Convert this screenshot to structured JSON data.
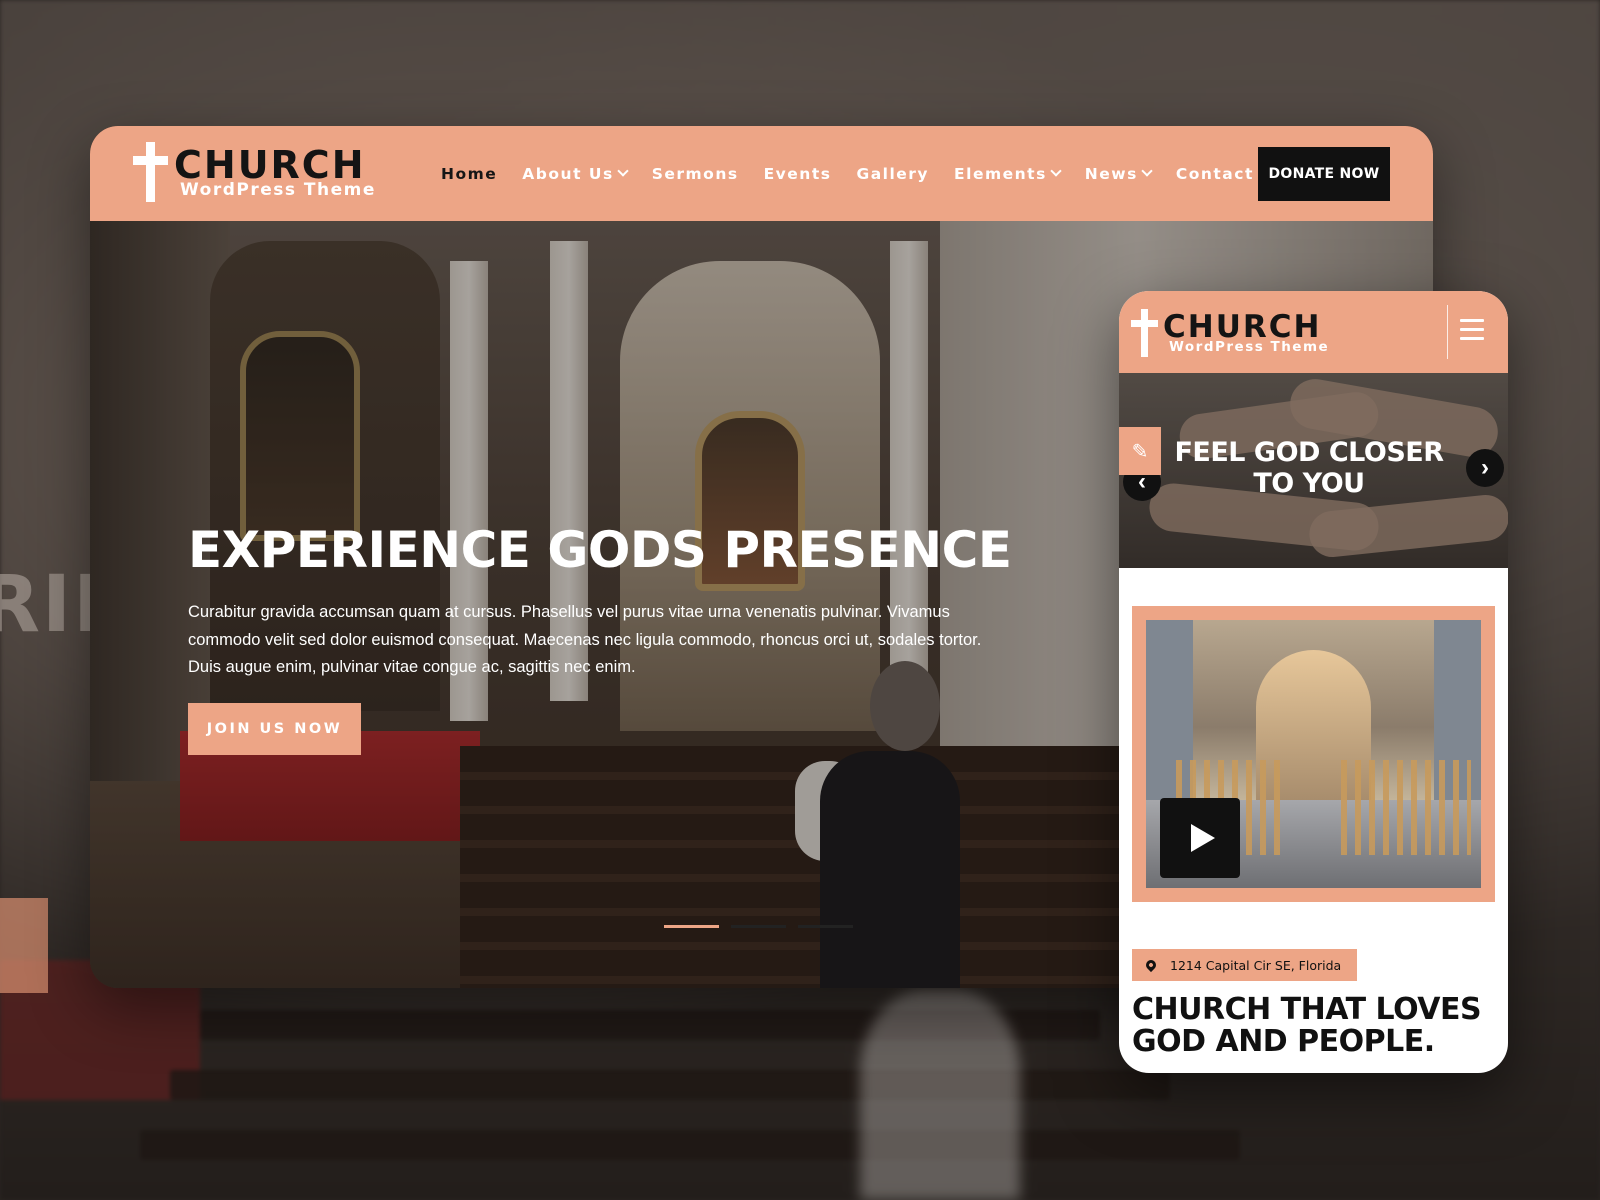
{
  "brand": {
    "name": "CHURCH",
    "tagline": "WordPress Theme",
    "accent": "#eda586",
    "dark": "#111111"
  },
  "desktop": {
    "nav": [
      {
        "label": "Home",
        "active": true,
        "dropdown": false
      },
      {
        "label": "About Us",
        "active": false,
        "dropdown": true
      },
      {
        "label": "Sermons",
        "active": false,
        "dropdown": false
      },
      {
        "label": "Events",
        "active": false,
        "dropdown": false
      },
      {
        "label": "Gallery",
        "active": false,
        "dropdown": false
      },
      {
        "label": "Elements",
        "active": false,
        "dropdown": true
      },
      {
        "label": "News",
        "active": false,
        "dropdown": true
      },
      {
        "label": "Contact Us",
        "active": false,
        "dropdown": false
      }
    ],
    "donate_label": "DONATE NOW",
    "hero": {
      "title": "EXPERIENCE GODS PRESENCE",
      "text": "Curabitur gravida accumsan quam at cursus. Phasellus vel purus vitae urna venenatis pulvinar. Vivamus commodo velit sed dolor euismod consequat. Maecenas nec ligula commodo, rhoncus orci ut, sodales tortor. Duis augue enim, pulvinar vitae congue ac, sagittis nec enim.",
      "button_label": "JOIN US NOW",
      "slides_total": 3,
      "slide_active": 1
    }
  },
  "mobile": {
    "slide_title": "FEEL GOD CLOSER TO YOU",
    "address": "1214 Capital Cir SE, Florida",
    "heading": "CHURCH THAT LOVES GOD AND PEOPLE."
  },
  "background": {
    "partial_text": "RIE"
  }
}
